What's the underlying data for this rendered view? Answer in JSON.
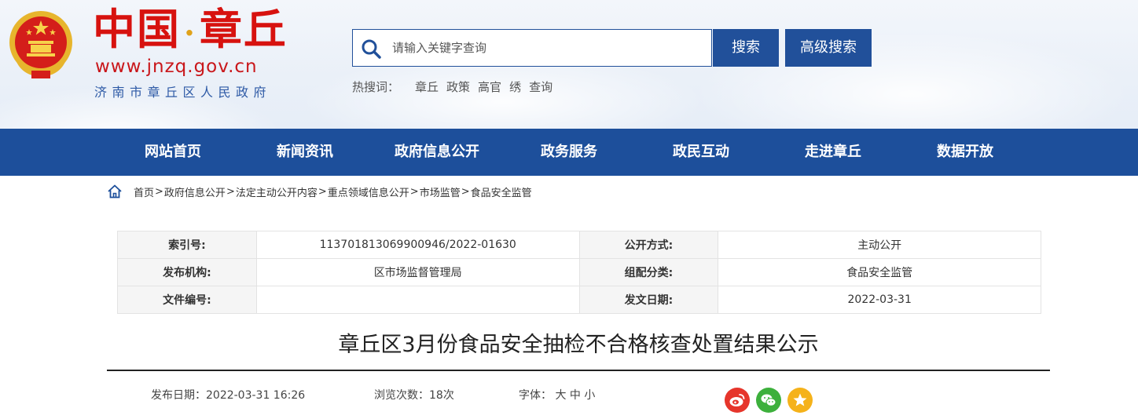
{
  "brand": {
    "title_part1": "中国",
    "title_sep": "·",
    "title_part2": "章丘",
    "url": "www.jnzq.gov.cn",
    "gov_name": "济南市章丘区人民政府"
  },
  "search": {
    "placeholder": "请输入关键字查询",
    "button_label": "搜索",
    "advanced_label": "高级搜索"
  },
  "hot_words": {
    "label": "热搜词：",
    "items": [
      "章丘",
      "政策",
      "高官",
      "绣",
      "查询"
    ]
  },
  "nav": {
    "items": [
      "网站首页",
      "新闻资讯",
      "政府信息公开",
      "政务服务",
      "政民互动",
      "走进章丘",
      "数据开放"
    ]
  },
  "breadcrumb": {
    "items": [
      "首页",
      "政府信息公开",
      "法定主动公开内容",
      "重点领域信息公开",
      "市场监管",
      "食品安全监管"
    ],
    "separator": ">"
  },
  "info": {
    "index_label": "索引号:",
    "index_value": "113701813069900946/2022-01630",
    "mode_label": "公开方式:",
    "mode_value": "主动公开",
    "org_label": "发布机构:",
    "org_value": "区市场监督管理局",
    "category_label": "组配分类:",
    "category_value": "食品安全监管",
    "docno_label": "文件编号:",
    "docno_value": "",
    "date_label": "发文日期:",
    "date_value": "2022-03-31"
  },
  "article": {
    "title": "章丘区3月份食品安全抽检不合格核查处置结果公示",
    "publish_label": "发布日期：",
    "publish_value": "2022-03-31 16:26",
    "views_label": "浏览次数：",
    "views_value": "18次",
    "font_label": "字体：",
    "font_large": "大",
    "font_medium": "中",
    "font_small": "小"
  },
  "share": {
    "icons": [
      "weibo-icon",
      "wechat-icon",
      "favorite-star-icon"
    ],
    "colors": {
      "weibo": "#e6352b",
      "wechat": "#3db03c",
      "star": "#f5b21a"
    }
  },
  "colors": {
    "primary_blue": "#1d4f9b",
    "brand_red": "#d7120f"
  }
}
